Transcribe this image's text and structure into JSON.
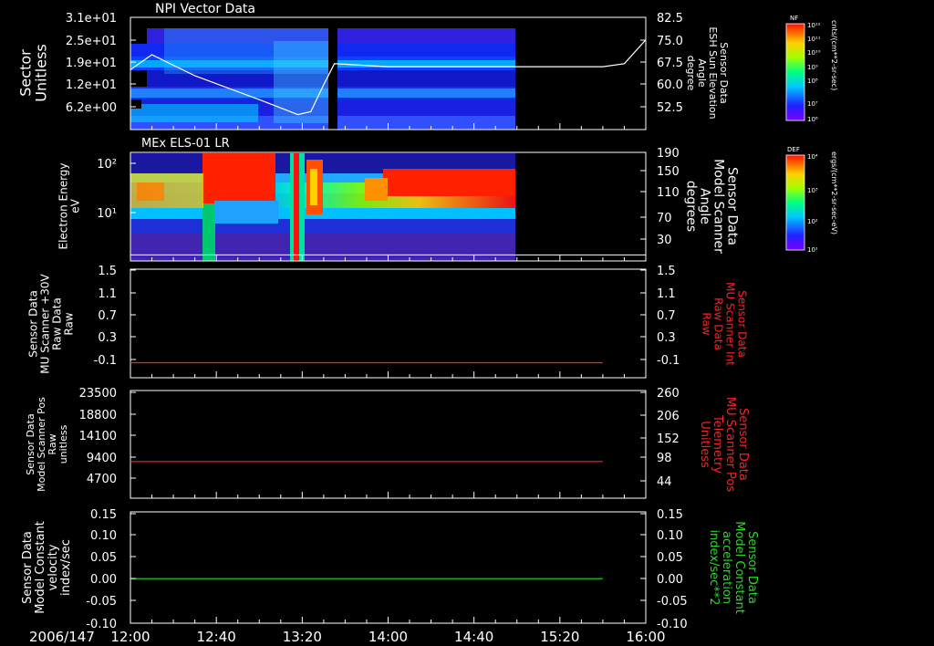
{
  "date_label": "2006/147",
  "time_ticks": [
    "12:00",
    "12:40",
    "13:20",
    "14:00",
    "14:40",
    "15:20",
    "16:00"
  ],
  "colors": {
    "red": "#ff2020",
    "green": "#22dd22",
    "white": "#ffffff"
  },
  "panels": [
    {
      "id": "npi",
      "title": "NPI Vector Data",
      "left_label": [
        "Sector",
        "Unitless"
      ],
      "left_ticks": [
        "3.1e+01",
        "2.5e+01",
        "1.9e+01",
        "1.2e+01",
        "6.2e+00"
      ],
      "right_label": [
        "Sensor Data",
        "ESH Sun Elevation",
        "Angle",
        "degree"
      ],
      "right_ticks": [
        "82.5",
        "75.0",
        "67.5",
        "60.0",
        "52.5"
      ],
      "right_label_color": "#ffffff"
    },
    {
      "id": "els",
      "title": "MEx ELS-01 LR",
      "left_label": [
        "Electron Energy",
        "eV"
      ],
      "left_ticks": [
        "10²",
        "10¹"
      ],
      "right_label": [
        "Sensor Data",
        "Model Scanner",
        "Angle",
        "degrees"
      ],
      "right_ticks": [
        "190",
        "150",
        "110",
        "70",
        "30"
      ],
      "right_label_color": "#ffffff"
    },
    {
      "id": "raw30",
      "title": "",
      "left_label": [
        "Sensor Data",
        "MU Scanner +30V",
        "Raw Data",
        "Raw"
      ],
      "left_ticks": [
        "1.5",
        "1.1",
        "0.7",
        "0.3",
        "-0.1"
      ],
      "right_label": [
        "Sensor Data",
        "MU Scanner Int",
        "Raw Data",
        "Raw"
      ],
      "right_ticks": [
        "1.5",
        "1.1",
        "0.7",
        "0.3",
        "-0.1"
      ],
      "right_label_color": "#ff2020"
    },
    {
      "id": "pos",
      "title": "",
      "left_label": [
        "Sensor Data",
        "Model Scanner Pos",
        "Raw",
        "unitless"
      ],
      "left_ticks": [
        "23500",
        "18800",
        "14100",
        "9400",
        "4700"
      ],
      "right_label": [
        "Sensor Data",
        "MU Scanner Pos",
        "Telemetry",
        "Unitless"
      ],
      "right_ticks": [
        "260",
        "206",
        "152",
        "98",
        "44"
      ],
      "right_label_color": "#ff2020"
    },
    {
      "id": "vel",
      "title": "",
      "left_label": [
        "Sensor Data",
        "Model Constant",
        "velocity",
        "index/sec"
      ],
      "left_ticks": [
        "0.15",
        "0.10",
        "0.05",
        "0.00",
        "-0.05",
        "-0.10"
      ],
      "right_label": [
        "Sensor Data",
        "Model Constant",
        "acceleration",
        "index/sec**2"
      ],
      "right_ticks": [
        "0.15",
        "0.10",
        "0.05",
        "0.00",
        "-0.05",
        "-0.10"
      ],
      "right_label_color": "#22dd22"
    }
  ],
  "colorbars": [
    {
      "label": "NF",
      "top": "10¹²",
      "ticks": [
        "10¹¹",
        "10¹⁰",
        "10⁹",
        "10⁸",
        "10⁷"
      ],
      "bottom": "10⁶",
      "units": "cnts/(cm**2-sr-sec)"
    },
    {
      "label": "DEF",
      "top": "10⁴",
      "ticks": [
        "10³",
        "10²"
      ],
      "bottom": "10¹",
      "units": "ergs/(cm**2-sr-sec-eV)"
    }
  ],
  "chart_data": [
    {
      "type": "heatmap",
      "title": "NPI Vector Data",
      "ylabel": "Sector Unitless",
      "x_range": [
        "12:00",
        "16:00"
      ],
      "data_extent_x": [
        "12:00",
        "14:55"
      ],
      "y_ticks": [
        31,
        25,
        19,
        12,
        6.2
      ],
      "overlay_series": {
        "name": "Sensor Data ESH Sun Elevation Angle",
        "unit": "degree",
        "ylim": [
          45,
          82.5
        ],
        "x": [
          "12:00",
          "12:10",
          "12:30",
          "13:00",
          "13:18",
          "13:24",
          "13:30",
          "13:35",
          "14:00",
          "15:40",
          "15:50",
          "16:00"
        ],
        "y": [
          65,
          70,
          63,
          55,
          50,
          51,
          60,
          67,
          66,
          66,
          67,
          75
        ]
      }
    },
    {
      "type": "heatmap",
      "title": "MEx ELS-01 LR",
      "ylabel": "Electron Energy eV",
      "x_range": [
        "12:00",
        "16:00"
      ],
      "data_extent_x": [
        "12:00",
        "14:55"
      ],
      "overlay_series": {
        "name": "Sensor Data Model Scanner Angle",
        "unit": "degrees",
        "ylim": [
          10,
          190
        ],
        "x": [
          "12:00",
          "16:00"
        ],
        "y": [
          20,
          20
        ]
      }
    },
    {
      "type": "line",
      "ylim": [
        -0.3,
        1.5
      ],
      "series": [
        {
          "name": "Sensor Data MU Scanner Int Raw Data Raw",
          "color": "#ff2020",
          "x": [
            "12:00",
            "15:40"
          ],
          "y": [
            -0.05,
            -0.05
          ]
        }
      ]
    },
    {
      "type": "line",
      "ylim": [
        0,
        23500
      ],
      "series": [
        {
          "name": "Sensor Data MU Scanner Pos Telemetry Unitless",
          "color": "#ff2020",
          "x": [
            "12:00",
            "15:40"
          ],
          "y": [
            8000,
            8000
          ]
        }
      ]
    },
    {
      "type": "line",
      "ylim": [
        -0.1,
        0.15
      ],
      "series": [
        {
          "name": "Sensor Data Model Constant acceleration index/sec**2",
          "color": "#22dd22",
          "x": [
            "12:00",
            "15:40"
          ],
          "y": [
            0.0,
            0.0
          ]
        }
      ]
    }
  ]
}
